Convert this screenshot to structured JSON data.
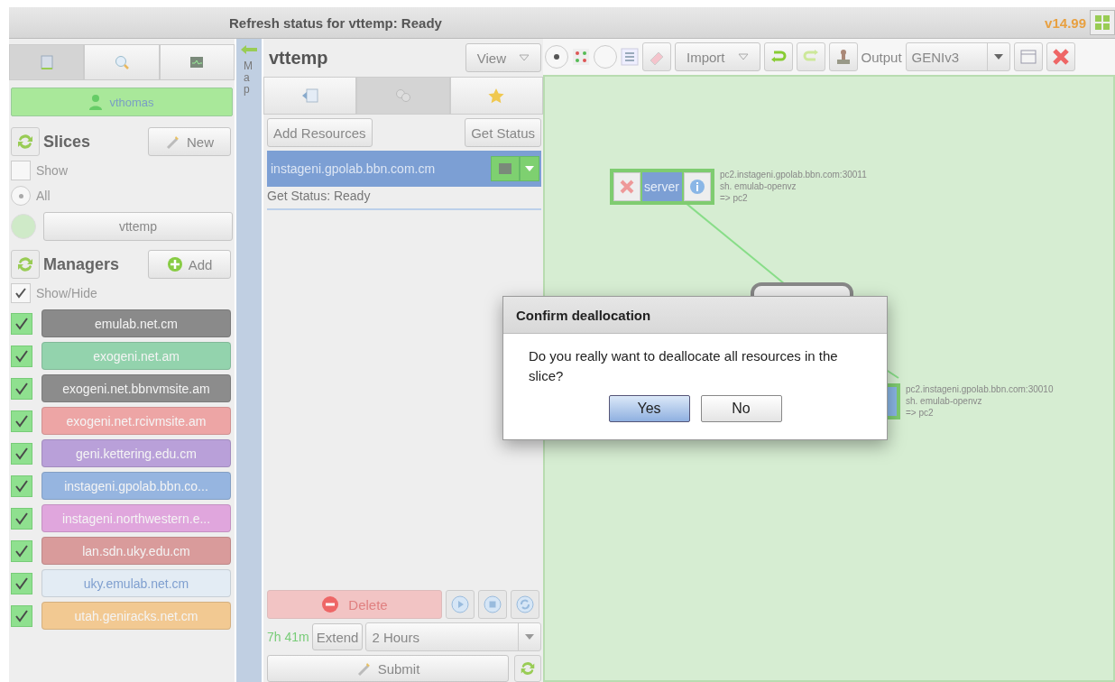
{
  "title_bar": {
    "status": "Refresh status for vttemp: Ready",
    "version": "v14.99"
  },
  "left_tabs": [
    {
      "selected": true
    },
    {
      "selected": false
    },
    {
      "selected": false
    }
  ],
  "user": {
    "name": "vthomas"
  },
  "slices": {
    "heading": "Slices",
    "new_button": "New",
    "show": {
      "label": "Show",
      "checked": false
    },
    "all": {
      "label": "All",
      "selected": true
    },
    "items": [
      {
        "name": "vttemp"
      }
    ]
  },
  "managers": {
    "heading": "Managers",
    "add_button": "Add",
    "show_hide": {
      "label": "Show/Hide",
      "checked": true
    },
    "items": [
      {
        "name": "emulab.net.cm",
        "checked": true,
        "color": "#8a8a8a"
      },
      {
        "name": "exogeni.net.am",
        "checked": true,
        "color": "#93d3ad"
      },
      {
        "name": "exogeni.net.bbnvmsite.am",
        "checked": true,
        "color": "#8c8c8c"
      },
      {
        "name": "exogeni.net.rcivmsite.am",
        "checked": true,
        "color": "#eda5a5"
      },
      {
        "name": "geni.kettering.edu.cm",
        "checked": true,
        "color": "#b9a0d9"
      },
      {
        "name": "instageni.gpolab.bbn.co...",
        "checked": true,
        "color": "#96b5e0"
      },
      {
        "name": "instageni.northwestern.e...",
        "checked": true,
        "color": "#e0a6dd"
      },
      {
        "name": "lan.sdn.uky.edu.cm",
        "checked": true,
        "color": "#d99b9b"
      },
      {
        "name": "uky.emulab.net.cm",
        "checked": true,
        "color": "#e3ecf4"
      },
      {
        "name": "utah.geniracks.net.cm",
        "checked": true,
        "color": "#f2c992"
      }
    ]
  },
  "map_strip": {
    "label": "Map"
  },
  "slice_panel": {
    "title": "vttemp",
    "view_button": "View",
    "tabs": [
      {
        "selected": false
      },
      {
        "selected": true
      },
      {
        "selected": false
      }
    ],
    "add_resources": "Add Resources",
    "get_status": "Get Status",
    "aggregates": [
      {
        "name": "instageni.gpolab.bbn.com.cm",
        "status": "Get Status: Ready",
        "selected": true
      }
    ],
    "delete_button": "Delete",
    "time_left": "7h 41m",
    "extend_button": "Extend",
    "extend_duration": "2 Hours",
    "submit_button": "Submit"
  },
  "toolbar": {
    "modes": [
      {
        "selected": true
      },
      {
        "selected": false
      }
    ],
    "import_button": "Import",
    "output_label": "Output",
    "output_format": "GENIv3"
  },
  "canvas": {
    "nodes": [
      {
        "kind": "node",
        "name": "server",
        "lines": [
          "pc2.instageni.gpolab.bbn.com:30011",
          "sh. emulab-openvz",
          "=> pc2"
        ]
      },
      {
        "kind": "link"
      },
      {
        "kind": "partial",
        "lines": [
          "pc2.instageni.gpolab.bbn.com:30010",
          "sh. emulab-openvz",
          "=> pc2"
        ]
      }
    ]
  },
  "dialog": {
    "title": "Confirm deallocation",
    "message": "Do you really want to deallocate all resources in the slice?",
    "buttons": [
      {
        "label": "Yes",
        "selected": true
      },
      {
        "label": "No",
        "selected": false
      }
    ]
  }
}
